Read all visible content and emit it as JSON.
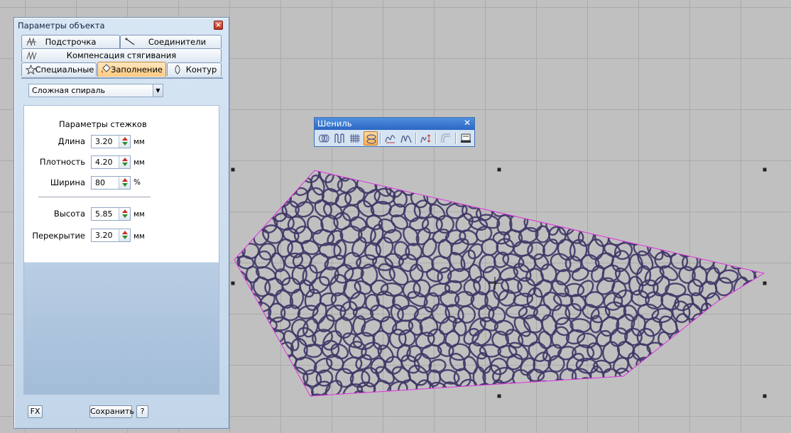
{
  "panel": {
    "title": "Параметры объекта",
    "tabs": {
      "stitching": "Подстрочка",
      "connectors": "Соединители",
      "pull_compensation": "Компенсация стягивания",
      "special": "Специальные",
      "fill": "Заполнение",
      "outline": "Контур"
    },
    "active_tab": "Заполнение",
    "fill_type": "Сложная спираль",
    "params_heading": "Параметры стежков",
    "params": {
      "length": {
        "label": "Длина",
        "value": "3.20",
        "unit": "мм"
      },
      "density": {
        "label": "Плотность",
        "value": "4.20",
        "unit": "мм"
      },
      "width": {
        "label": "Ширина",
        "value": "80",
        "unit": "%"
      },
      "height": {
        "label": "Высота",
        "value": "5.85",
        "unit": "мм"
      },
      "overlap": {
        "label": "Перекрытие",
        "value": "3.20",
        "unit": "мм"
      }
    },
    "buttons": {
      "fx": "FX",
      "save": "Сохранить",
      "help": "?"
    }
  },
  "chenille_toolbar": {
    "title": "Шениль",
    "close": "✕",
    "tools": [
      "chain-loops-icon",
      "column-icon",
      "grid-fill-icon",
      "spiral-fill-icon",
      "moss-curves-icon",
      "moss-loops-icon",
      "moss-height-icon",
      "arc-icon",
      "machine-icon"
    ],
    "active_tool": "spiral-fill-icon"
  },
  "colors": {
    "thread": "#3f3566",
    "outline": "#e030e0",
    "canvas": "#c0c0c0",
    "accent_active": "#ffcb80"
  }
}
